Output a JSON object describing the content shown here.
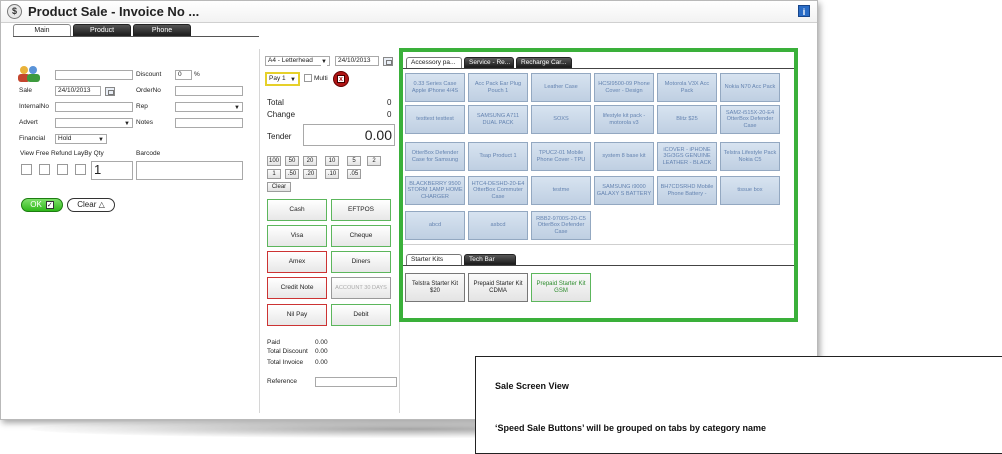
{
  "window": {
    "title": "Product Sale - Invoice No ...",
    "app_icon": "$"
  },
  "tabs": [
    "Main",
    "Product",
    "Phone"
  ],
  "left": {
    "discount_label": "Discount",
    "discount_value": "0",
    "percent": "%",
    "sale_label": "Sale",
    "sale_date": "24/10/2013",
    "orderno_label": "OrderNo",
    "internalno_label": "InternalNo",
    "rep_label": "Rep",
    "advert_label": "Advert",
    "notes_label": "Notes",
    "financial_label": "Financial",
    "financial_value": "Hold",
    "col_headers": "View  Free  Refund LayBy  Qty",
    "barcode_label": "Barcode",
    "qty_value": "1",
    "ok_label": "OK",
    "clear_label": "Clear"
  },
  "middle": {
    "format_value": "A4 - Letterhead",
    "date_value": "24/10/2013",
    "pay_value": "Pay 1",
    "multi_label": "Multi",
    "total_label": "Total",
    "total_value": "0",
    "change_label": "Change",
    "change_value": "0",
    "tender_label": "Tender",
    "tender_value": "0.00",
    "numpad_row1": [
      "100",
      "50",
      "20",
      "10",
      "5",
      "2"
    ],
    "numpad_row2": [
      "1",
      ".50",
      ".20",
      ".10",
      ".05"
    ],
    "clear_label": "Clear",
    "pay_buttons": [
      {
        "label": "Cash",
        "style": "g"
      },
      {
        "label": "EFTPOS",
        "style": "g"
      },
      {
        "label": "Visa",
        "style": "g"
      },
      {
        "label": "Cheque",
        "style": "g"
      },
      {
        "label": "Amex",
        "style": "r"
      },
      {
        "label": "Diners",
        "style": "g"
      },
      {
        "label": "Credit Note",
        "style": "r"
      },
      {
        "label": "ACCOUNT 30 DAYS",
        "style": "dim"
      },
      {
        "label": "Nil Pay",
        "style": "r"
      },
      {
        "label": "Debit",
        "style": "g"
      }
    ],
    "paid_label": "Paid",
    "paid_value": "0.00",
    "total_discount_label": "Total Discount",
    "total_discount_value": "0.00",
    "total_invoice_label": "Total Invoice",
    "total_invoice_value": "0.00",
    "reference_label": "Reference"
  },
  "speed": {
    "tabs": [
      "Accessory pa...",
      "Service - Re...",
      "Recharge Car..."
    ],
    "buttons": [
      "0.33 Series Case Apple iPhone 4/4S",
      "Acc Pack Ear Plug Pouch 1",
      "Leather Case",
      "HCSI9500-09 Phone Cover - Design",
      "Motorola V3X Acc Pack",
      "Nokia N70 Acc Pack",
      "testtest testtest",
      "SAMSUNG A711 DUAL PACK",
      "SOXS",
      "lifestyle kit pack - motorola v3",
      "Blitz $25",
      "SAM2-i515X-20-E4 OtterBox Defender Case",
      "OtterBox Defender Case for Samsung",
      "Tsap Product 1",
      "TPUC2-01 Mobile Phone Cover - TPU",
      "system 8 base kit",
      "iCOVER - iPHONE 3G/3GS GENUINE LEATHER - BLACK",
      "Telstra Lifestyle Pack Nokia C5",
      "BLACKBERRY 9500 STORM 1AMP HOME CHARGER",
      "HTC4-DESHD-20-E4 OtterBox Commuter Case",
      "testme",
      "SAMSUNG i9000 GALAXY S BATTERY",
      "BH7CDSRHD Mobile Phone Battery -",
      "tissue box",
      "abcd",
      "asbcd",
      "RBB2-9700S-20-C5 OtterBox Defender Case"
    ],
    "tabs2": [
      "Starter Kits",
      "Tech Bar"
    ],
    "kits": [
      {
        "label": "Telstra Starter Kit $20",
        "style": ""
      },
      {
        "label": "Prepaid Starter Kit CDMA",
        "style": ""
      },
      {
        "label": "Prepaid Starter Kit GSM",
        "style": "g"
      }
    ]
  },
  "callout": {
    "line1": "Sale Screen View",
    "line2": "‘Speed Sale Buttons’ will be grouped on tabs by category name"
  },
  "colors": {
    "accent_green": "#3ab03a",
    "speed_button": "#c9d7e8",
    "info_blue": "#2a6cc6"
  }
}
